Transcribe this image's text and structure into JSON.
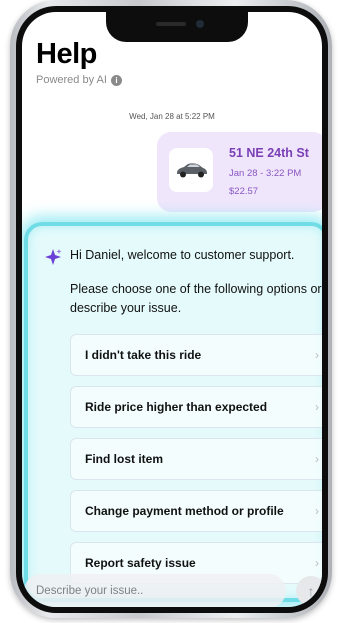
{
  "status_bar": {
    "right_text": ""
  },
  "header": {
    "title": "Help",
    "subtitle": "Powered by AI",
    "info_glyph": "i"
  },
  "conversation": {
    "timestamp": "Wed, Jan 28 at 5:22 PM",
    "ride_card": {
      "address": "51 NE 24th St",
      "date": "Jan 28 - 3:22 PM",
      "price": "$22.57",
      "icon": "car-icon"
    }
  },
  "support_panel": {
    "sparkle_icon": "sparkle-icon",
    "greeting": "Hi Daniel, welcome to customer support.",
    "instructions": "Please choose one of the following options or describe your issue.",
    "options": [
      {
        "label": "I didn't take this ride"
      },
      {
        "label": "Ride price higher than expected"
      },
      {
        "label": "Find lost item"
      },
      {
        "label": "Change payment method or profile"
      },
      {
        "label": "Report safety issue"
      }
    ],
    "chevron_glyph": "›"
  },
  "composer": {
    "placeholder": "Describe your issue..",
    "send_glyph": "↑"
  },
  "colors": {
    "accent_purple": "#7a3fb6",
    "panel_glow": "#6fdce6",
    "card_bg": "#efe6fb"
  }
}
